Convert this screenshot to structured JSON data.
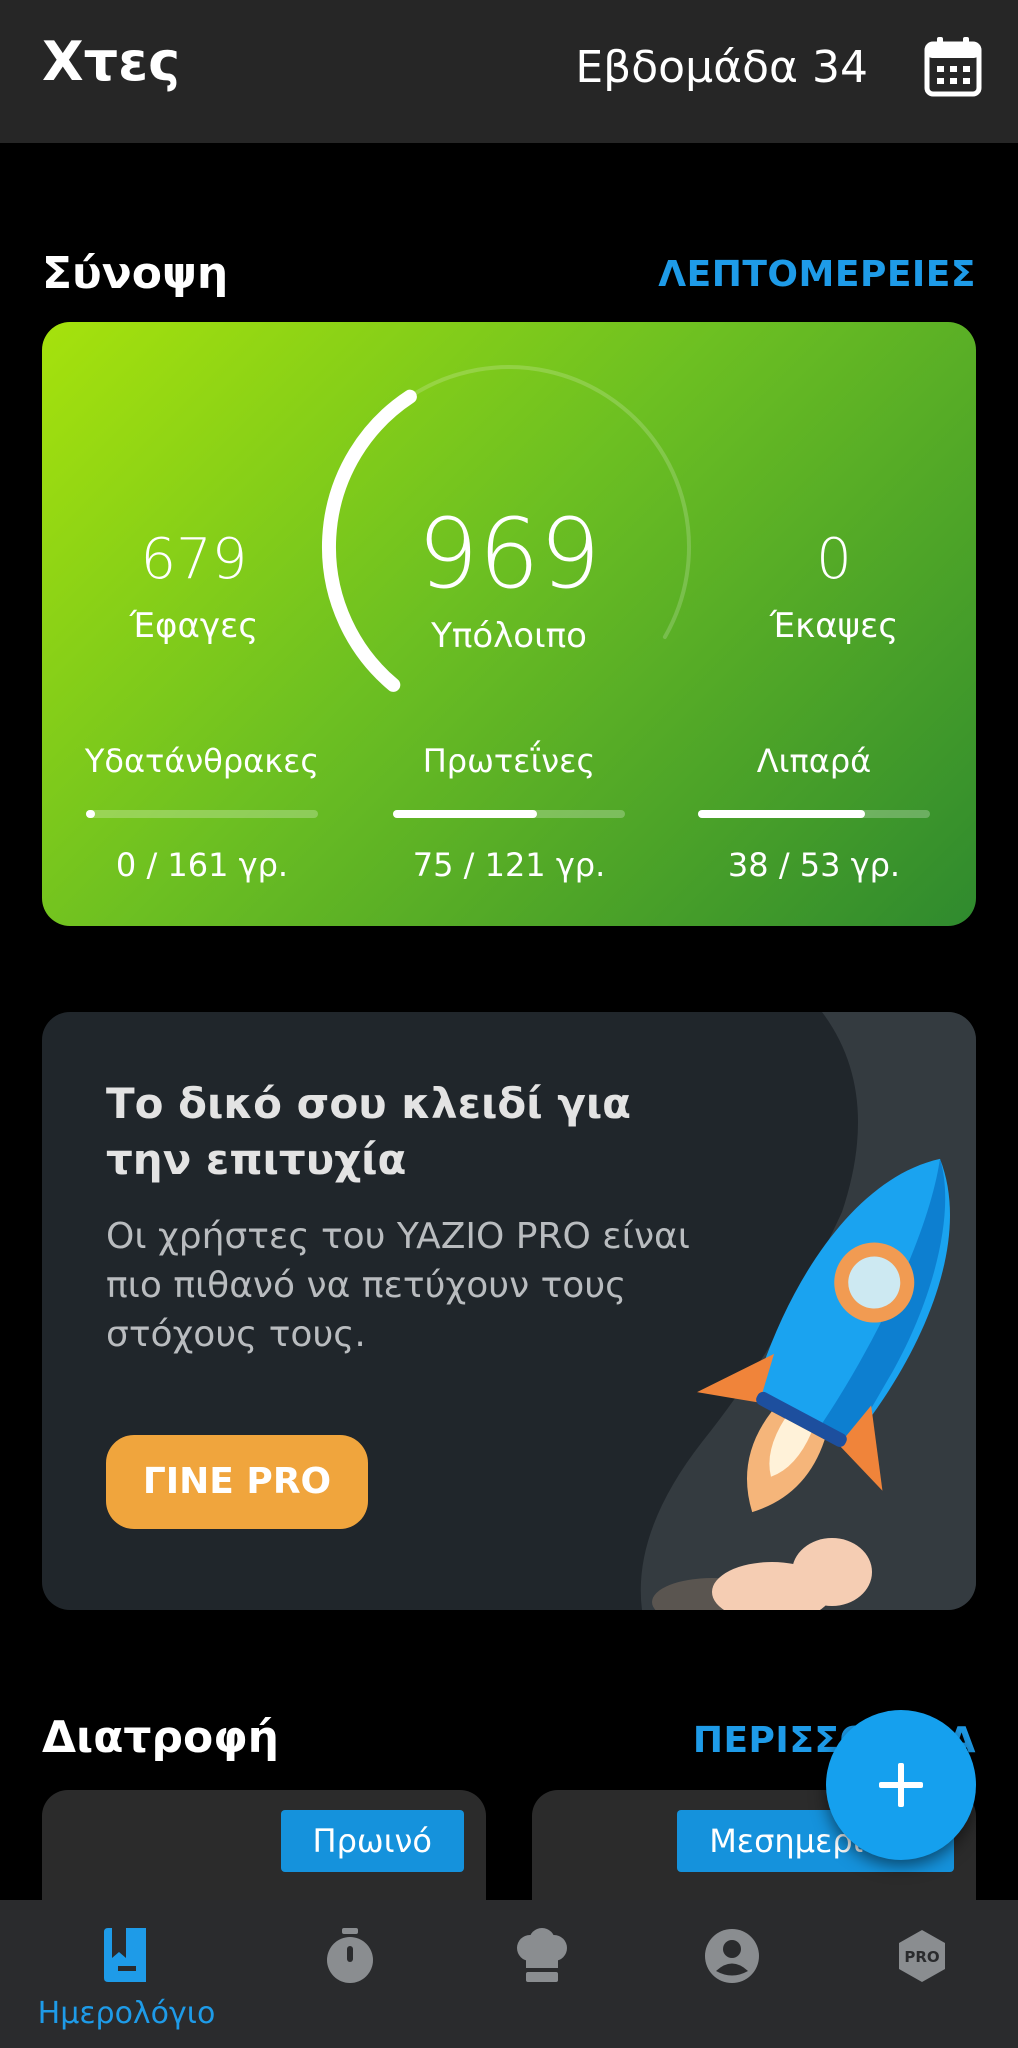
{
  "header": {
    "title": "Χτες",
    "week": "Εβδομάδα 34"
  },
  "summary": {
    "section_title": "Σύνοψη",
    "details_link": "ΛΕΠΤΟΜΕΡΕΙΕΣ",
    "eaten": {
      "value": "679",
      "label": "Έφαγες"
    },
    "remaining": {
      "value": "969",
      "label": "Υπόλοιπο"
    },
    "burned": {
      "value": "0",
      "label": "Έκαψες"
    },
    "macros": [
      {
        "name": "Υδατάνθρακες",
        "value": "0 / 161 γρ.",
        "progress": 0.0
      },
      {
        "name": "Πρωτεΐνες",
        "value": "75 / 121 γρ.",
        "progress": 0.62
      },
      {
        "name": "Λιπαρά",
        "value": "38 / 53 γρ.",
        "progress": 0.72
      }
    ],
    "ring_progress": 0.41,
    "colors": {
      "gradient_start": "#a6e20c",
      "gradient_end": "#2f8a2e"
    }
  },
  "promo": {
    "title": "Το δικό σου κλειδί για την επιτυχία",
    "body": "Οι χρήστες του YAZIO PRO είναι πιο πιθανό να πετύχουν τους στόχους τους.",
    "button": "ΓΙΝΕ PRO",
    "illustration": "rocket-icon",
    "button_color": "#f0a53d"
  },
  "nutrition": {
    "section_title": "Διατροφή",
    "more_link": "ΠΕΡΙΣΣΟΤΕΡΑ",
    "meals": [
      "Πρωινό",
      "Μεσημεριανό"
    ]
  },
  "fab": {
    "icon": "plus-icon"
  },
  "bottom_nav": {
    "items": [
      {
        "icon": "diary-icon",
        "label": "Ημερολόγιο",
        "active": true
      },
      {
        "icon": "stopwatch-icon"
      },
      {
        "icon": "chef-hat-icon"
      },
      {
        "icon": "profile-icon"
      },
      {
        "icon": "pro-badge-icon",
        "text": "PRO"
      }
    ]
  },
  "accent_color": "#1e9be8"
}
